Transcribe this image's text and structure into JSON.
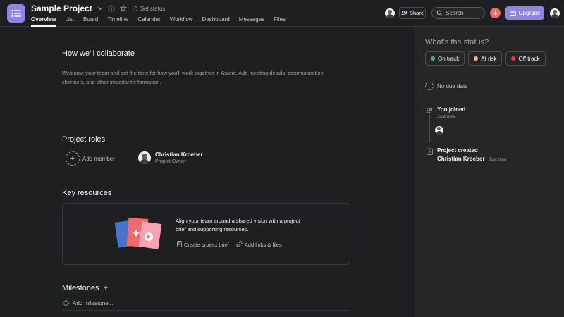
{
  "header": {
    "project_title": "Sample Project",
    "set_status": "Set status",
    "tabs": [
      "Overview",
      "List",
      "Board",
      "Timeline",
      "Calendar",
      "Workflow",
      "Dashboard",
      "Messages",
      "Files"
    ],
    "active_tab": "Overview",
    "share_label": "Share",
    "search_placeholder": "Search",
    "upgrade_label": "Upgrade"
  },
  "main": {
    "collab": {
      "heading": "How we'll collaborate",
      "description": "Welcome your team and set the tone for how you'll work together in Asana. Add meeting details, communication channels, and other important information."
    },
    "roles": {
      "heading": "Project roles",
      "add_member": "Add member",
      "member_name": "Christian Kroeber",
      "member_role": "Project Owner"
    },
    "resources": {
      "heading": "Key resources",
      "text": "Align your team around a shared vision with a project brief and supporting resources.",
      "create_brief": "Create project brief",
      "add_links": "Add links & files"
    },
    "milestones": {
      "heading": "Milestones",
      "add_milestone": "Add milestone..."
    }
  },
  "status_panel": {
    "title": "What's the status?",
    "buttons": [
      {
        "label": "On track",
        "color": "#5da283"
      },
      {
        "label": "At risk",
        "color": "#f1bd6c"
      },
      {
        "label": "Off track",
        "color": "#e8384f"
      }
    ],
    "no_due_date": "No due date",
    "joined_title": "You joined",
    "joined_time": "Just now",
    "created_title": "Project created",
    "created_by": "Christian Kroeber",
    "created_time": "Just now"
  },
  "colors": {
    "accent": "#8d84e8",
    "add_button": "#f06a6a",
    "background": "#1e1f21"
  }
}
